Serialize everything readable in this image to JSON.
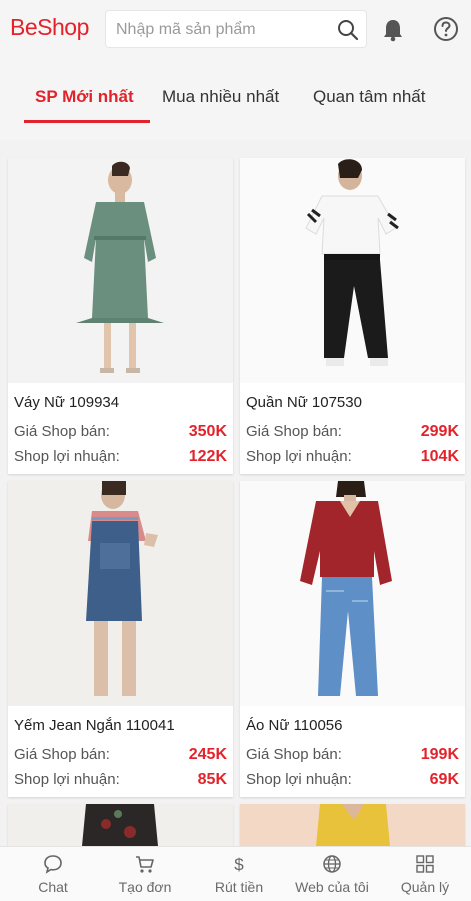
{
  "header": {
    "logo_be": "Be",
    "logo_shop": "Shop",
    "search_placeholder": "Nhập mã sản phẩm"
  },
  "tabs": [
    {
      "label": "SP Mới nhất",
      "active": true
    },
    {
      "label": "Mua nhiều nhất",
      "active": false
    },
    {
      "label": "Quan tâm nhất",
      "active": false
    }
  ],
  "products": [
    {
      "name": "Váy Nữ 109934",
      "price_label": "Giá Shop bán:",
      "price": "350K",
      "profit_label": "Shop lợi nhuận:",
      "profit": "122K"
    },
    {
      "name": "Quần Nữ 107530",
      "price_label": "Giá Shop bán:",
      "price": "299K",
      "profit_label": "Shop lợi nhuận:",
      "profit": "104K"
    },
    {
      "name": "Yếm Jean Ngắn 110041",
      "price_label": "Giá Shop bán:",
      "price": "245K",
      "profit_label": "Shop lợi nhuận:",
      "profit": "85K"
    },
    {
      "name": "Áo Nữ 110056",
      "price_label": "Giá Shop bán:",
      "price": "199K",
      "profit_label": "Shop lợi nhuận:",
      "profit": "69K"
    }
  ],
  "bottom_nav": [
    {
      "label": "Chat",
      "icon": "chat-icon"
    },
    {
      "label": "Tạo đơn",
      "icon": "cart-icon"
    },
    {
      "label": "Rút tiền",
      "icon": "dollar-icon"
    },
    {
      "label": "Web của tôi",
      "icon": "globe-icon"
    },
    {
      "label": "Quản lý",
      "icon": "grid-icon"
    }
  ],
  "colors": {
    "accent": "#e3232b",
    "background": "#f2f2f2"
  }
}
